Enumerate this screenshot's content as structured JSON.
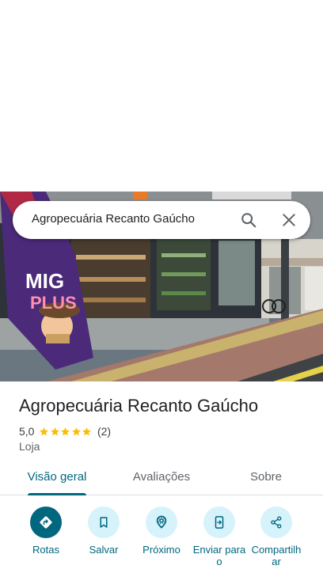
{
  "search": {
    "query": "Agropecuária Recanto Gaúcho",
    "search_icon": "search-icon",
    "close_icon": "close-icon"
  },
  "photo": {
    "flag_text_line1": "MIG",
    "flag_text_line2": "PLUS"
  },
  "place": {
    "name": "Agropecuária Recanto Gaúcho",
    "rating": "5,0",
    "stars": 5,
    "review_count": "(2)",
    "category": "Loja"
  },
  "tabs": [
    {
      "label": "Visão geral",
      "active": true
    },
    {
      "label": "Avaliações",
      "active": false
    },
    {
      "label": "Sobre",
      "active": false
    }
  ],
  "actions": [
    {
      "label": "Rotas",
      "icon": "directions-icon"
    },
    {
      "label": "Salvar",
      "icon": "bookmark-icon"
    },
    {
      "label": "Próximo",
      "icon": "nearby-icon"
    },
    {
      "label": "Enviar para o",
      "icon": "send-to-phone-icon"
    },
    {
      "label": "Compartilhar",
      "icon": "share-icon"
    }
  ],
  "colors": {
    "accent": "#00677f",
    "action_bg": "#d6f2fb",
    "star": "#fbbc04"
  }
}
